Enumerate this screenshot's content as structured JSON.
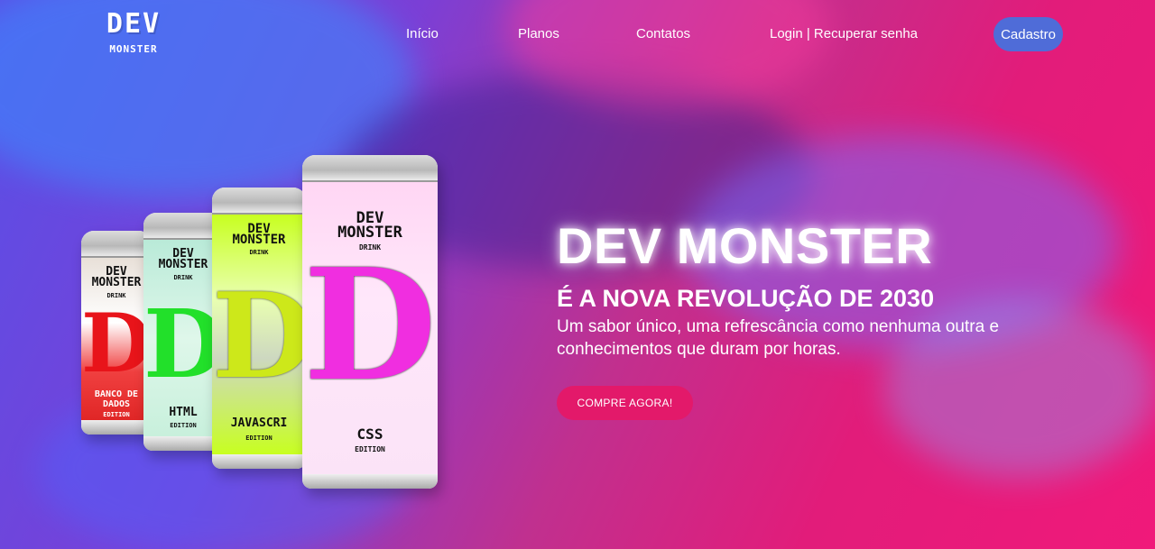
{
  "brand": {
    "title": "DEV",
    "subtitle": "MONSTER"
  },
  "nav": {
    "items": [
      "Início",
      "Planos",
      "Contatos",
      "Login | Recuperar senha"
    ],
    "cta": "Cadastro"
  },
  "hero": {
    "title": "DEV MONSTER",
    "subtitle": "É A NOVA REVOLUÇÃO DE 2030",
    "text": "Um sabor único, uma refrescância como nenhuma outra e conhecimentos que duram por horas.",
    "button": "COMPRE AGORA!"
  },
  "cans": [
    {
      "brand_top": "DEV",
      "brand_bottom": "MONSTER",
      "drink": "DRINK",
      "letter": "D",
      "edition": "BANCO DE DADOS",
      "edition_sub": "EDITION"
    },
    {
      "brand_top": "DEV",
      "brand_bottom": "MONSTER",
      "drink": "DRINK",
      "letter": "D",
      "edition": "HTML",
      "edition_sub": "EDITION"
    },
    {
      "brand_top": "DEV",
      "brand_bottom": "MONSTER",
      "drink": "DRINK",
      "letter": "D",
      "edition": "JAVASCRI",
      "edition_sub": "EDITION"
    },
    {
      "brand_top": "DEV",
      "brand_bottom": "MONSTER",
      "drink": "DRINK",
      "letter": "D",
      "edition": "CSS",
      "edition_sub": "EDITION"
    }
  ],
  "colors": {
    "accent_button": "#e3196a",
    "signup_button": "#4f6cd8",
    "bg_left": "#5a4fe6",
    "bg_right": "#f0197a"
  }
}
